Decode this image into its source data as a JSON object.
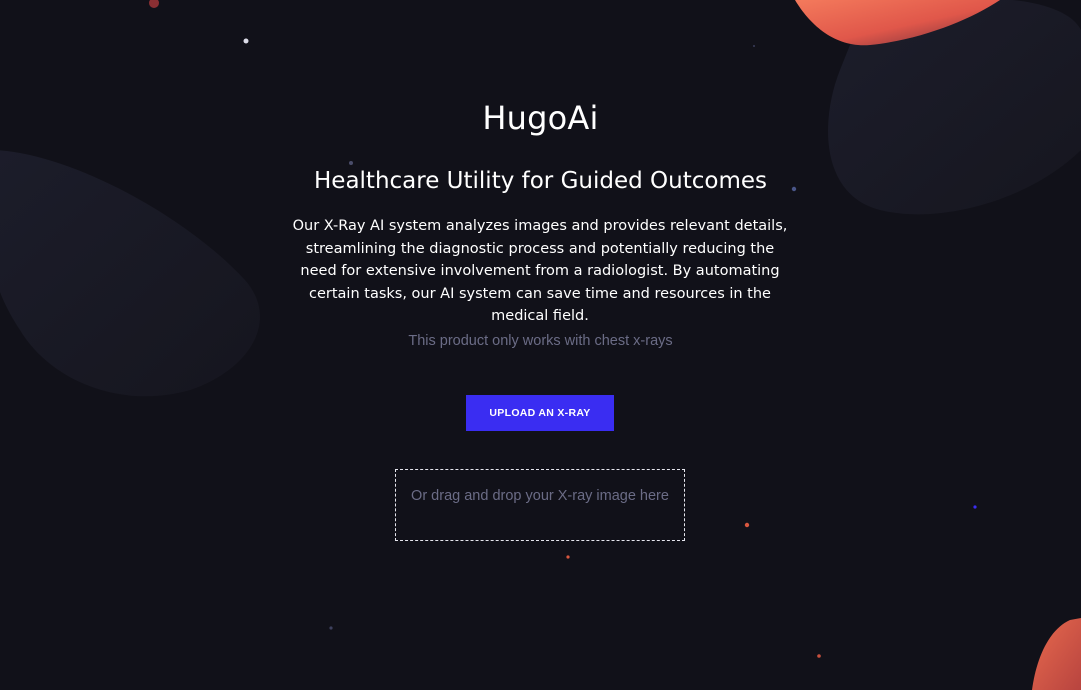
{
  "header": {
    "app_title": "HugoAi",
    "subtitle": "Healthcare Utility for Guided Outcomes"
  },
  "main": {
    "description": "Our X-Ray AI system analyzes images and provides relevant details, streamlining the diagnostic process and potentially reducing the need for extensive involvement from a radiologist. By automating certain tasks, our AI system can save time and resources in the medical field.",
    "note": "This product only works with chest x-rays",
    "upload_button_label": "UPLOAD AN X-RAY",
    "drop_zone_label": "Or drag and drop your X-ray image here"
  },
  "colors": {
    "background": "#111119",
    "accent": "#3a2df2",
    "muted_text": "#6b6c86",
    "blob_orange": "#e8624a"
  }
}
